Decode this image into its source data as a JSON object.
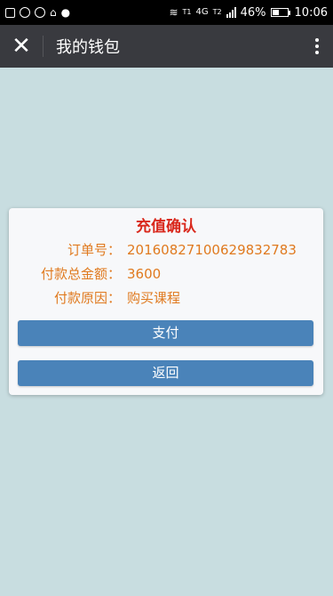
{
  "status_bar": {
    "network": "4G",
    "sim_labels": [
      "T1",
      "T2"
    ],
    "battery_percent": "46%",
    "time": "10:06"
  },
  "app_bar": {
    "title": "我的钱包",
    "close_icon": "close-icon",
    "more_icon": "more-vertical-icon"
  },
  "dialog": {
    "title": "充值确认",
    "rows": [
      {
        "label": "订单号：",
        "value": "2016082710062983278​3"
      },
      {
        "label": "付款总金额：",
        "value": "3600"
      },
      {
        "label": "付款原因：",
        "value": "购买课程"
      }
    ],
    "pay_button": "支付",
    "back_button": "返回"
  },
  "colors": {
    "background": "#c8dde0",
    "app_bar": "#393a3f",
    "title_red": "#d9281c",
    "text_orange": "#e07a1f",
    "button_blue": "#4a83b9"
  }
}
